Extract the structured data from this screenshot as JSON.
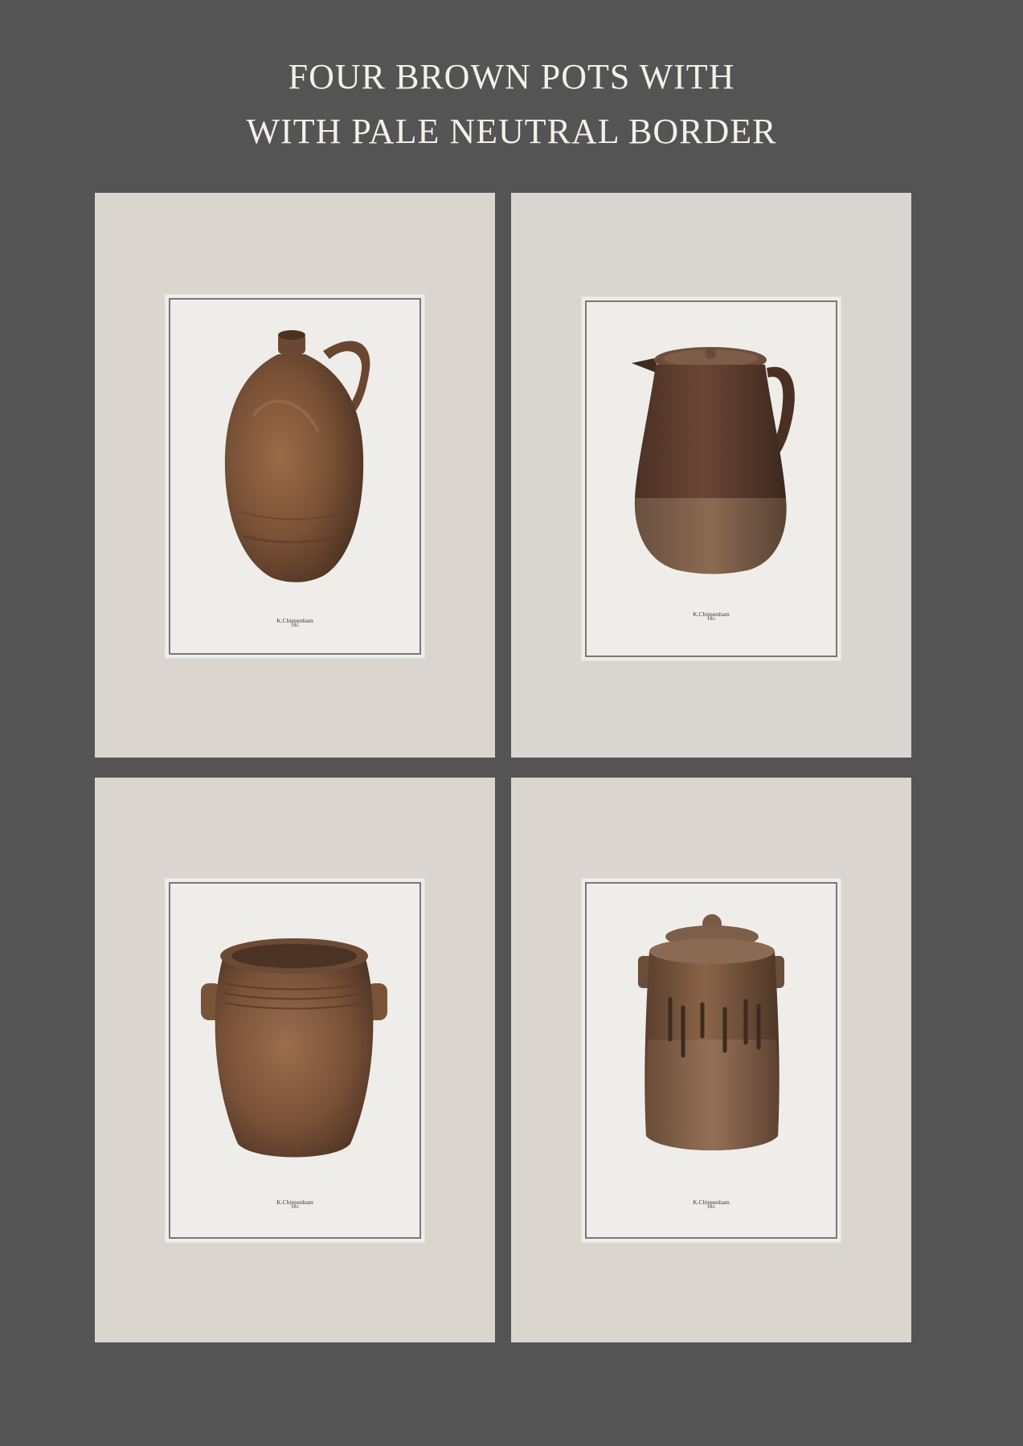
{
  "title": {
    "line1": "FOUR BROWN POTS WITH",
    "line2": "WITH PALE NEUTRAL BORDER"
  },
  "colors": {
    "background": "#545454",
    "mat": "#dbd5d0",
    "print": "#efedea",
    "pot_brown": "#6e4a33"
  },
  "prints": [
    {
      "subject": "jug-with-handle",
      "artist": "K.Chippenham",
      "year": "1965"
    },
    {
      "subject": "lidded-pitcher",
      "artist": "K.Chippenham",
      "year": "1965"
    },
    {
      "subject": "two-handled-crock",
      "artist": "K.Chippenham",
      "year": "1965"
    },
    {
      "subject": "lidded-churn-jar",
      "artist": "K.Chippenham",
      "year": "1965"
    }
  ]
}
